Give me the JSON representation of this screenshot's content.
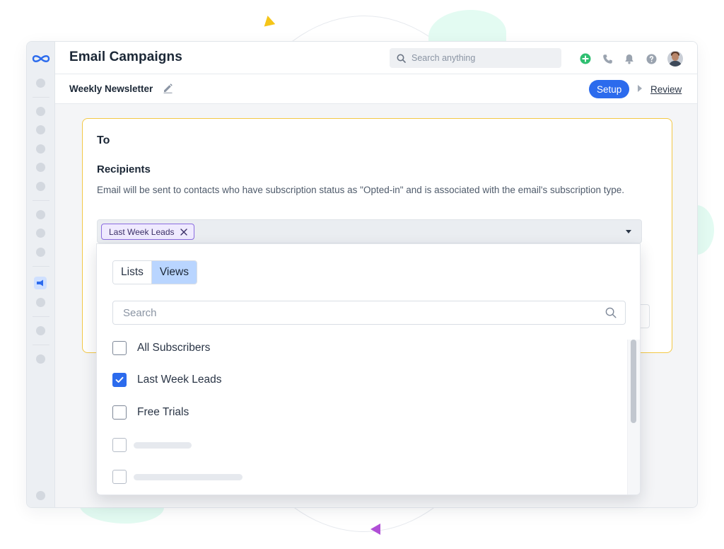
{
  "app": {
    "title": "Email Campaigns"
  },
  "search": {
    "placeholder": "Search anything"
  },
  "campaign": {
    "name": "Weekly Newsletter"
  },
  "steps": {
    "setup": "Setup",
    "review": "Review"
  },
  "card": {
    "title": "To",
    "recipients_label": "Recipients",
    "recipients_desc": "Email will be sent to contacts who have subscription status as \"Opted-in\" and is associated with the email's subscription type.",
    "selected_chip": "Last Week Leads"
  },
  "dropdown": {
    "tabs": [
      "Lists",
      "Views"
    ],
    "active_tab": "Views",
    "search_placeholder": "Search",
    "options": [
      {
        "label": "All Subscribers",
        "checked": false
      },
      {
        "label": "Last Week Leads",
        "checked": true
      },
      {
        "label": "Free Trials",
        "checked": false
      }
    ]
  },
  "icons": {
    "top": [
      "plus-circle-icon",
      "phone-icon",
      "bell-icon",
      "help-icon"
    ],
    "rail_active": "campaign-icon"
  },
  "colors": {
    "primary": "#2c6bed",
    "card_border": "#f3c846",
    "chip_border": "#8b6ce0",
    "add_green": "#2fbf71"
  }
}
